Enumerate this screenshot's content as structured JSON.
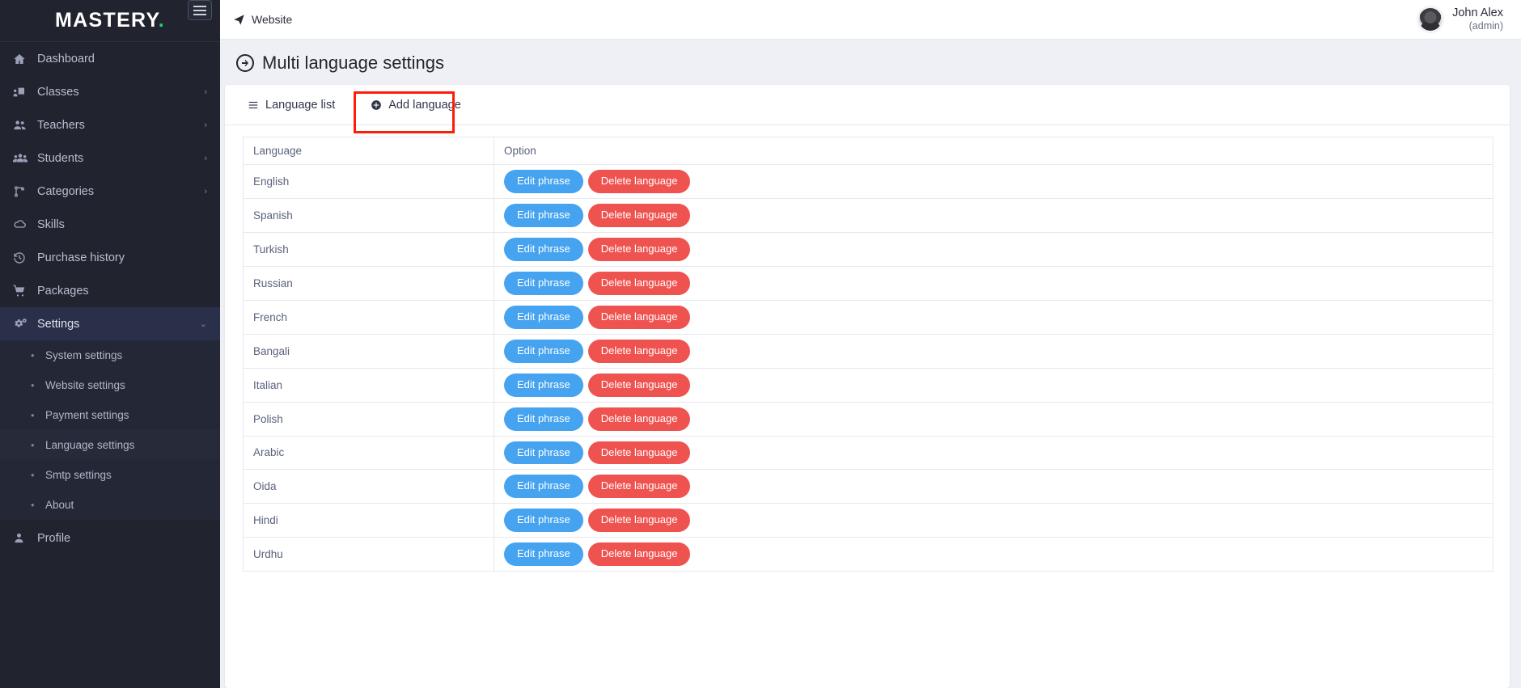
{
  "sidebar": {
    "logo": "MASTERY",
    "logo_dot": ".",
    "burger_icon": "hamburger-menu-icon",
    "items": [
      {
        "label": "Dashboard",
        "icon": "home-icon",
        "caret": ""
      },
      {
        "label": "Classes",
        "icon": "classroom-icon",
        "caret": "›"
      },
      {
        "label": "Teachers",
        "icon": "users-icon",
        "caret": "›"
      },
      {
        "label": "Students",
        "icon": "user-group-icon",
        "caret": "›"
      },
      {
        "label": "Categories",
        "icon": "sitemap-icon",
        "caret": "›"
      },
      {
        "label": "Skills",
        "icon": "cloud-icon",
        "caret": ""
      },
      {
        "label": "Purchase history",
        "icon": "history-icon",
        "caret": ""
      },
      {
        "label": "Packages",
        "icon": "cart-icon",
        "caret": ""
      },
      {
        "label": "Settings",
        "icon": "gears-icon",
        "caret": "⌄"
      }
    ],
    "subitems": [
      {
        "label": "System settings",
        "bullet": "•"
      },
      {
        "label": "Website settings",
        "bullet": "•"
      },
      {
        "label": "Payment settings",
        "bullet": "•"
      },
      {
        "label": "Language settings",
        "bullet": "•"
      },
      {
        "label": "Smtp settings",
        "bullet": "•"
      },
      {
        "label": "About",
        "bullet": "•"
      }
    ],
    "profile": {
      "label": "Profile",
      "icon": "person-icon"
    }
  },
  "topbar": {
    "website_label": "Website",
    "website_icon": "paper-plane-icon",
    "user_name": "John Alex",
    "user_role": "(admin)",
    "avatar_icon": "user-avatar"
  },
  "page": {
    "title": "Multi language settings",
    "title_icon": "circle-arrow-right-icon"
  },
  "tabs": [
    {
      "label": "Language list",
      "icon": "list-icon",
      "active": true
    },
    {
      "label": "Add language",
      "icon": "plus-circle-icon",
      "active": false
    }
  ],
  "annotation": {
    "target": "Add language",
    "color": "#fc1d08"
  },
  "table": {
    "headers": [
      "Language",
      "Option"
    ],
    "edit_label": "Edit phrase",
    "delete_label": "Delete language",
    "rows": [
      {
        "language": "English"
      },
      {
        "language": "Spanish"
      },
      {
        "language": "Turkish"
      },
      {
        "language": "Russian"
      },
      {
        "language": "French"
      },
      {
        "language": "Bangali"
      },
      {
        "language": "Italian"
      },
      {
        "language": "Polish"
      },
      {
        "language": "Arabic"
      },
      {
        "language": "Oida"
      },
      {
        "language": "Hindi"
      },
      {
        "language": "Urdhu"
      }
    ]
  },
  "colors": {
    "sidebar_bg": "#21242f",
    "sidebar_active": "#2a2f4a",
    "accent_green": "#2ecc71",
    "btn_edit": "#45a3ef",
    "btn_delete": "#ef5350",
    "annotation_red": "#fc1d08",
    "page_bg": "#eef0f5"
  }
}
